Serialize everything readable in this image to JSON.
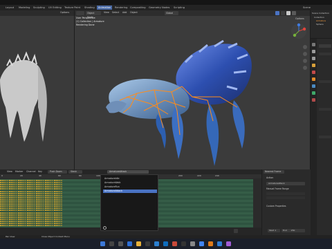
{
  "workspace_tabs": [
    "Layout",
    "Modeling",
    "Sculpting",
    "UV Editing",
    "Texture Paint",
    "Shading",
    "Animation",
    "Rendering",
    "Compositing",
    "Geometry Nodes",
    "Scripting"
  ],
  "active_tab": "Animation",
  "scene_label": "Scene",
  "left_view": {
    "options": "Options"
  },
  "main_view": {
    "mode": "Object Mode",
    "menus": [
      "View",
      "Select",
      "Add",
      "Object"
    ],
    "transform": "Global",
    "options": "Options",
    "overlay_lines": [
      "User Perspective",
      "(1) Collection | Armature",
      "Rendering Done"
    ]
  },
  "outliner": {
    "header": "Scene Collection",
    "items": [
      "Collection",
      "Armature",
      "Sphere"
    ]
  },
  "nla": {
    "menus": [
      "View",
      "Marker",
      "Channel",
      "Key"
    ],
    "push_down": "Push Down",
    "stash": "Stash",
    "action_field": "ArmatureAttack",
    "ruler_ticks": [
      "0",
      "20",
      "40",
      "60",
      "80",
      "100",
      "120",
      "140",
      "160",
      "180",
      "200",
      "220",
      "240"
    ],
    "frame_start_label": "Start",
    "frame_start": "1",
    "frame_end_label": "End",
    "frame_end": "250",
    "nearest_frame": "Nearest Frame"
  },
  "action_dropdown": {
    "items": [
      "ArmatureIdle",
      "ArmatureWalk",
      "ArmatureRun",
      "ArmatureAttack"
    ],
    "selected_index": 3
  },
  "action_panel": {
    "section_action": "Action",
    "action_name": "ArmatureAttack",
    "manual_frame_range": "Manual Frame Range",
    "custom_properties": "Custom Properties"
  },
  "statusbar": {
    "left": "Pan View",
    "center": "Close Object Context Menu"
  },
  "colors": {
    "accent": "#4a73c3",
    "keyframe": "#e0a82a",
    "strip": "#355d47",
    "armature": "#ff8c1a"
  }
}
